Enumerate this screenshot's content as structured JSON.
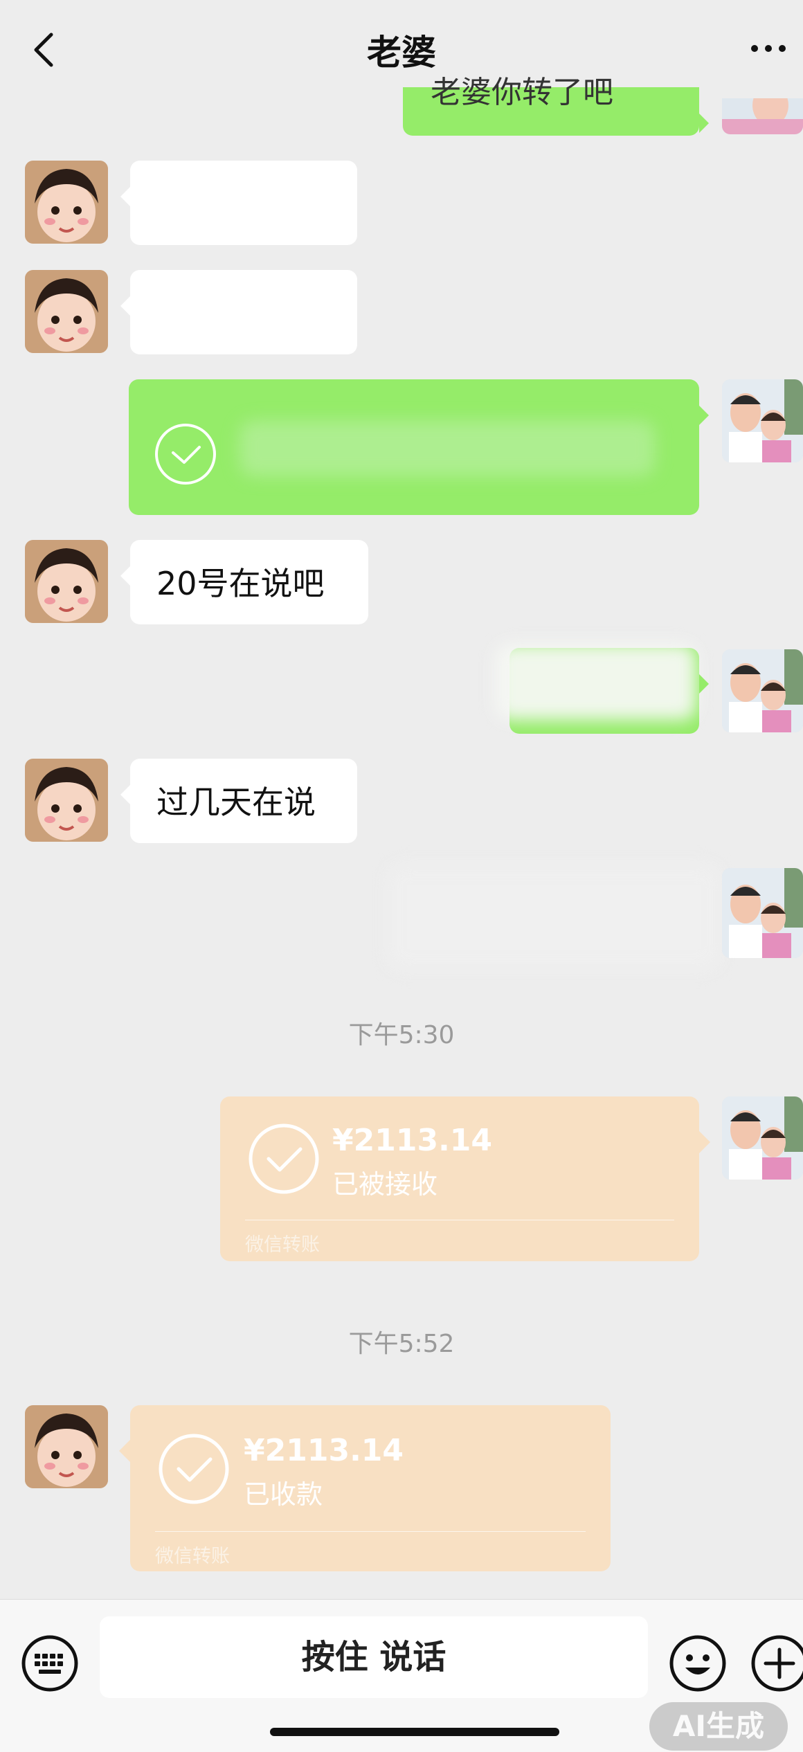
{
  "header": {
    "title": "老婆",
    "back_icon": "chevron-left-icon",
    "more_icon": "more-dots-icon"
  },
  "messages": {
    "m1_partial_out": "老婆你转了吧",
    "m6_in": "20号在说吧",
    "m8_in": "过几天在说"
  },
  "timestamps": [
    "下午5:30",
    "下午5:52"
  ],
  "transfers": [
    {
      "amount": "¥2113.14",
      "status": "已被接收",
      "label": "微信转账",
      "direction": "outgoing"
    },
    {
      "amount": "¥2113.14",
      "status": "已收款",
      "label": "微信转账",
      "direction": "incoming"
    }
  ],
  "input_bar": {
    "talk_label": "按住 说话",
    "keyboard_icon": "keyboard-icon",
    "emoji_icon": "emoji-icon",
    "plus_icon": "plus-circle-icon"
  },
  "watermark": "AI生成",
  "colors": {
    "background": "#ededed",
    "outgoing_bubble": "#95ec69",
    "incoming_bubble": "#ffffff",
    "transfer_card": "#f8e0c3"
  }
}
